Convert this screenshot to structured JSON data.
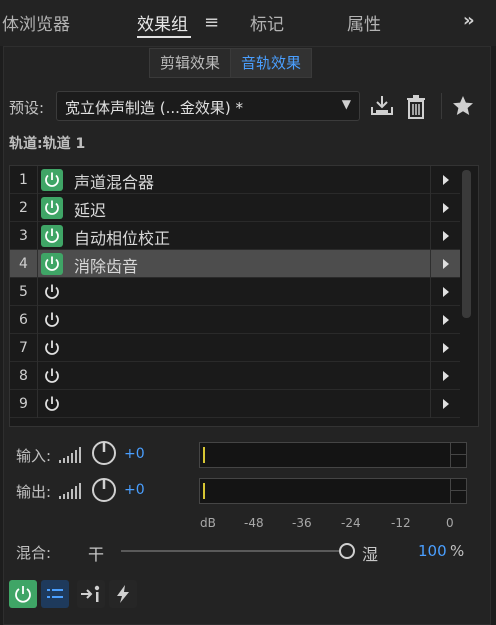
{
  "tabs": [
    {
      "label": "体浏览器"
    },
    {
      "label": "效果组"
    },
    {
      "label": "标记"
    },
    {
      "label": "属性"
    }
  ],
  "segments": {
    "clip": "剪辑效果",
    "track": "音轨效果"
  },
  "preset": {
    "label": "预设:",
    "value": "宽立体声制造 (...金效果)  *"
  },
  "track_label": "轨道:轨道 1",
  "rack": {
    "slots": [
      {
        "num": "1",
        "name": "声道混合器",
        "on": true
      },
      {
        "num": "2",
        "name": "延迟",
        "on": true
      },
      {
        "num": "3",
        "name": "自动相位校正",
        "on": true
      },
      {
        "num": "4",
        "name": "消除齿音",
        "on": true,
        "selected": true
      },
      {
        "num": "5",
        "name": "",
        "on": false
      },
      {
        "num": "6",
        "name": "",
        "on": false
      },
      {
        "num": "7",
        "name": "",
        "on": false
      },
      {
        "num": "8",
        "name": "",
        "on": false
      },
      {
        "num": "9",
        "name": "",
        "on": false
      }
    ]
  },
  "io": {
    "input": {
      "label": "输入:",
      "value": "+0"
    },
    "output": {
      "label": "输出:",
      "value": "+0"
    }
  },
  "scale": [
    "dB",
    "-48",
    "-36",
    "-24",
    "-12",
    "0"
  ],
  "mix": {
    "label": "混合:",
    "dry": "干",
    "wet": "湿",
    "value": "100",
    "unit": "%",
    "level_percent": 100
  },
  "colors": {
    "accent_blue": "#4a9fff",
    "power_green": "#3fa566",
    "meter_yellow": "#d7c633"
  }
}
